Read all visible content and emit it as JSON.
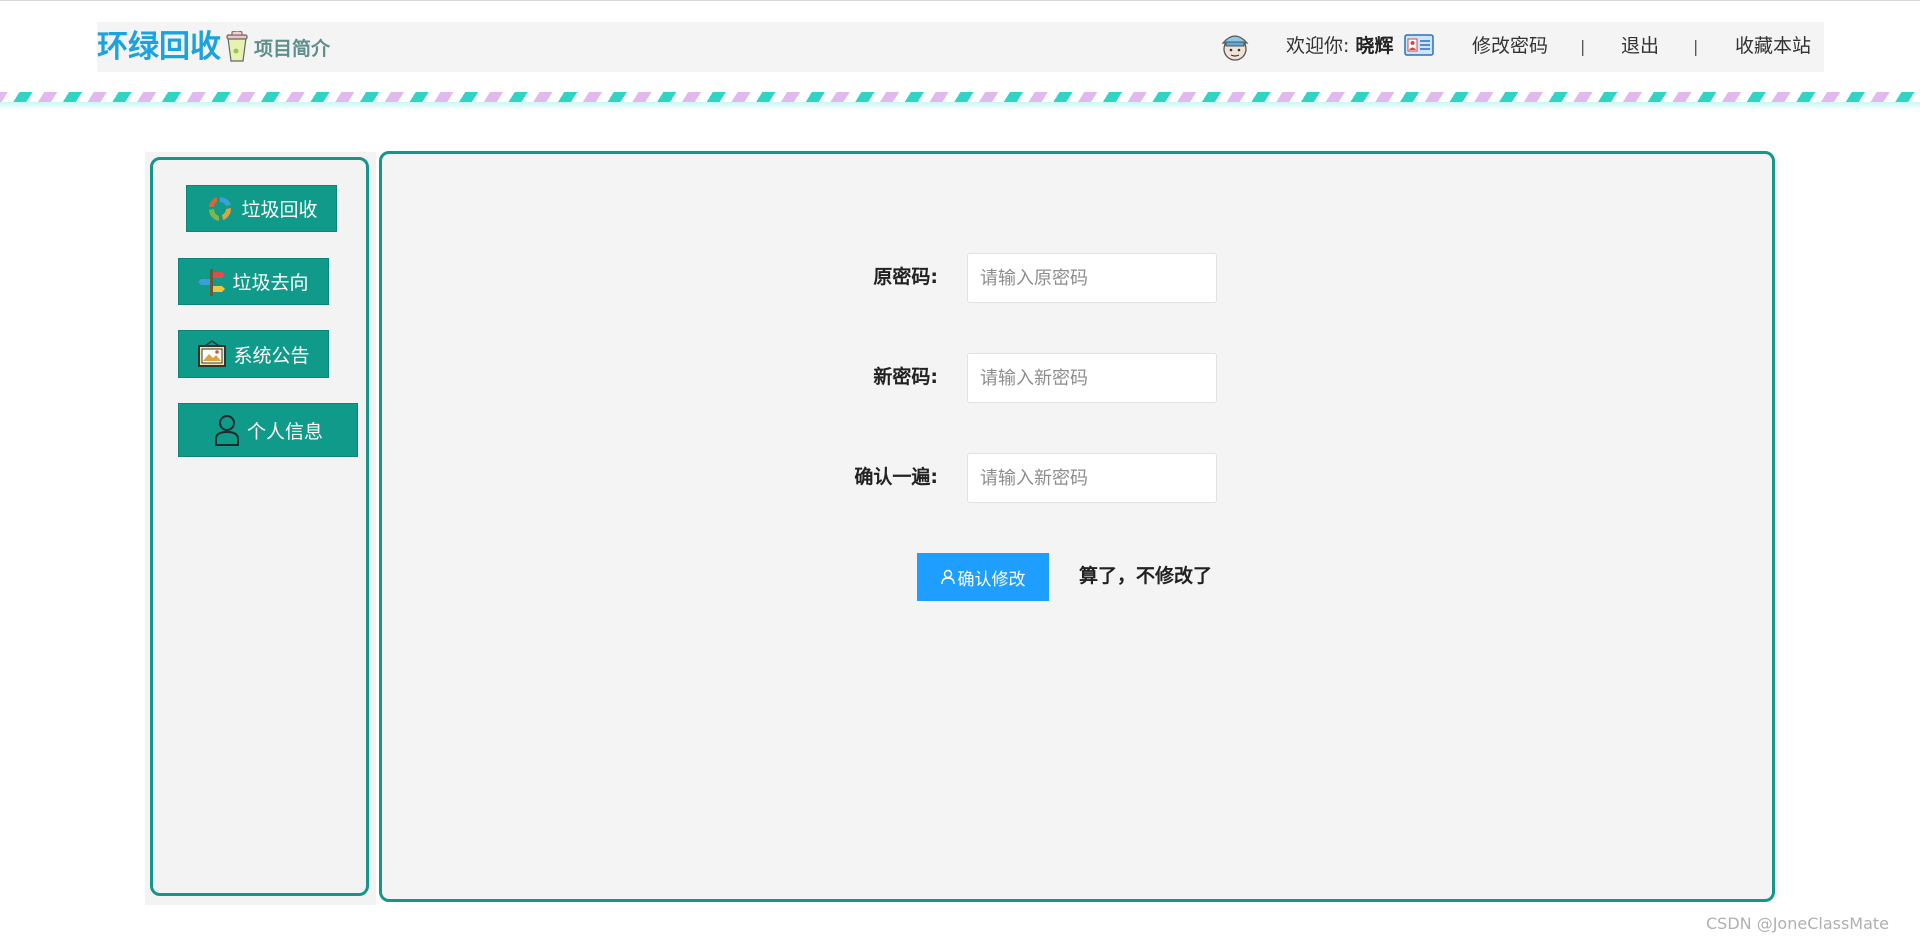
{
  "header": {
    "logo_text": "环绿回收",
    "project_intro": "项目简介",
    "welcome_prefix": "欢迎你:",
    "username": "晓辉",
    "change_password": "修改密码",
    "separator": "|",
    "logout": "退出",
    "bookmark": "收藏本站"
  },
  "sidebar": {
    "items": [
      {
        "label": "垃圾回收",
        "icon": "recycle-icon"
      },
      {
        "label": "垃圾去向",
        "icon": "signpost-icon"
      },
      {
        "label": "系统公告",
        "icon": "bulletin-icon"
      },
      {
        "label": "个人信息",
        "icon": "user-icon"
      }
    ]
  },
  "form": {
    "old_label": "原密码:",
    "old_placeholder": "请输入原密码",
    "new_label": "新密码:",
    "new_placeholder": "请输入新密码",
    "confirm_label": "确认一遍:",
    "confirm_placeholder": "请输入新密码",
    "submit": "确认修改",
    "cancel": "算了，不修改了"
  },
  "watermark": "CSDN @JoneClassMate",
  "colors": {
    "accent": "#14968a",
    "button_teal": "#0f9a8a",
    "logo_blue": "#1aa3dc",
    "primary_blue": "#1e9fff",
    "stripe_teal": "#2fd4c4",
    "stripe_pink": "#e2b9ee"
  }
}
